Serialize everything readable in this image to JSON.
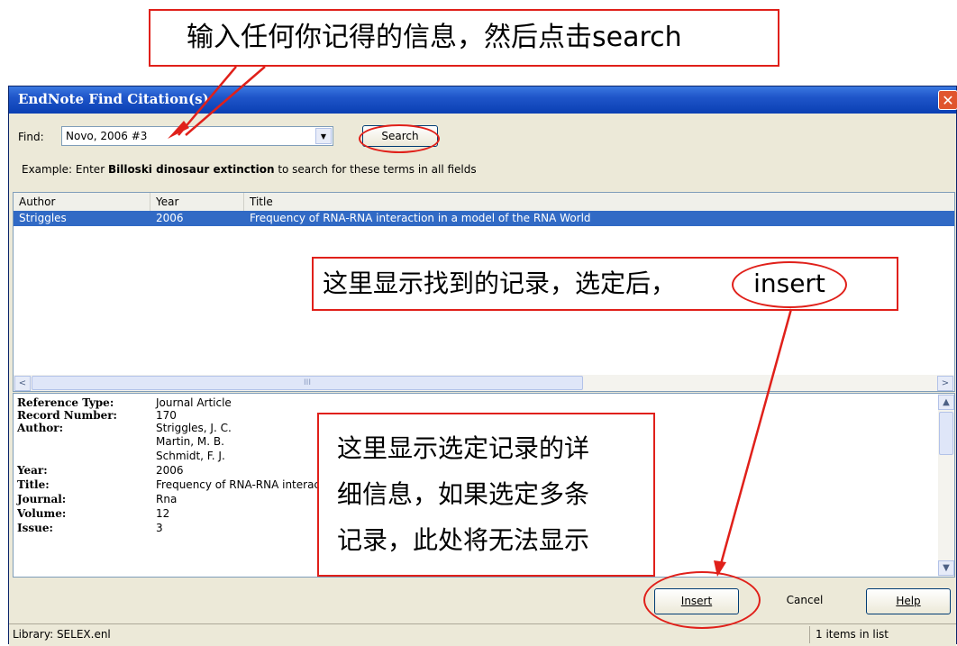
{
  "window": {
    "title": "EndNote Find Citation(s)",
    "close_glyph": "✕"
  },
  "find": {
    "label": "Find:",
    "value": "Novo, 2006 #3",
    "dropdown_glyph": "▼",
    "search_label": "Search"
  },
  "example": {
    "prefix": "Example: Enter ",
    "bold": "Billoski dinosaur extinction",
    "suffix": " to search for these terms in all fields"
  },
  "list": {
    "columns": [
      "Author",
      "Year",
      "Title"
    ],
    "rows": [
      {
        "author": "Striggles",
        "year": "2006",
        "title": "Frequency of RNA-RNA interaction in a model of the RNA World",
        "selected": true
      }
    ],
    "scroll_grip": "III",
    "left_arrow": "<",
    "right_arrow": ">"
  },
  "detail": {
    "fields": [
      {
        "label": "Reference Type:",
        "value": "Journal Article"
      },
      {
        "label": "Record Number:",
        "value": "170"
      },
      {
        "label": "Author:",
        "value": "Striggles, J. C."
      },
      {
        "label": "",
        "value": "Martin, M. B."
      },
      {
        "label": "",
        "value": "Schmidt, F. J."
      },
      {
        "label": "Year:",
        "value": "2006"
      },
      {
        "label": "Title:",
        "value": "Frequency of RNA-RNA interaction in a model of the RNA World"
      },
      {
        "label": "Journal:",
        "value": "Rna"
      },
      {
        "label": "Volume:",
        "value": "12"
      },
      {
        "label": "Issue:",
        "value": "3"
      }
    ],
    "up_arrow": "▲",
    "down_arrow": "▼"
  },
  "buttons": {
    "insert": "Insert",
    "cancel": "Cancel",
    "help": "Help"
  },
  "status": {
    "library": "Library: SELEX.enl",
    "count": "1 items in list"
  },
  "annotations": {
    "top": "输入任何你记得的信息，然后点击search",
    "middle_text": "这里显示找到的记录，选定后，",
    "middle_insert": "insert",
    "detail_lines": [
      "这里显示选定记录的详",
      "细信息，如果选定多条",
      "记录，此处将无法显示"
    ]
  },
  "colors": {
    "annotation_red": "#e0201a",
    "selection_blue": "#316ac5",
    "titlebar_blue": "#0a3fb3"
  }
}
